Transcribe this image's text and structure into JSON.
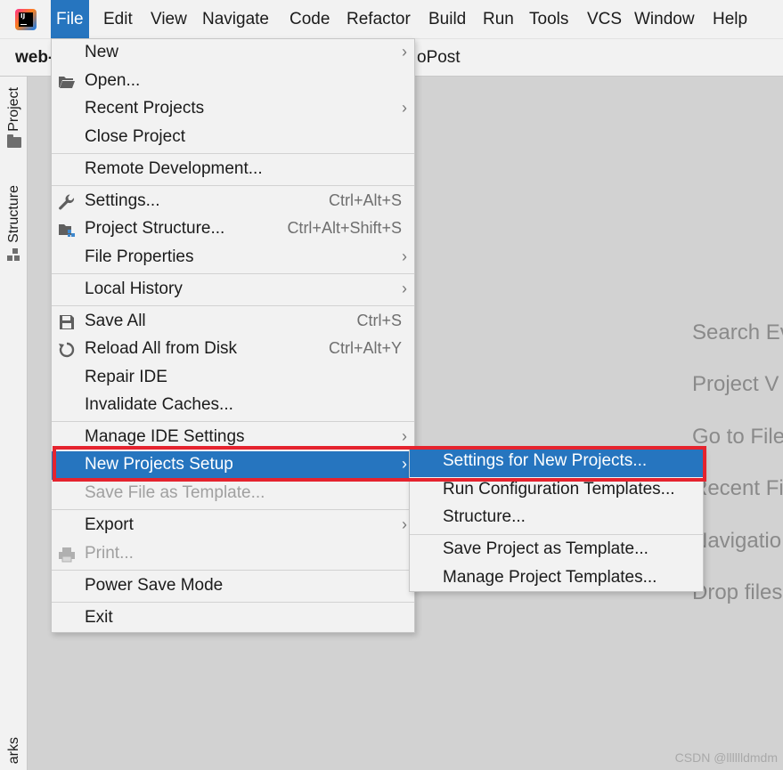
{
  "menubar": {
    "items": [
      {
        "label": "File",
        "active": true
      },
      {
        "label": "Edit"
      },
      {
        "label": "View"
      },
      {
        "label": "Navigate"
      },
      {
        "label": "Code"
      },
      {
        "label": "Refactor"
      },
      {
        "label": "Build"
      },
      {
        "label": "Run"
      },
      {
        "label": "Tools"
      },
      {
        "label": "VCS"
      },
      {
        "label": "Window"
      },
      {
        "label": "Help"
      }
    ]
  },
  "toolbar": {
    "project_name": "web-",
    "tab_tail": "oPost"
  },
  "left_strip": {
    "project_tab": "Project",
    "structure_tab": "Structure",
    "bookmarks_tab": "arks"
  },
  "welcome_hints": [
    "Search Ev",
    "Project V",
    "Go to File",
    "Recent Fi",
    "Navigatio",
    "Drop files"
  ],
  "file_menu": {
    "items": [
      {
        "label": "New",
        "submenu": true
      },
      {
        "label": "Open...",
        "icon": "folder-open-icon"
      },
      {
        "label": "Recent Projects",
        "submenu": true
      },
      {
        "label": "Close Project"
      },
      {
        "label": "Remote Development..."
      },
      {
        "label": "Settings...",
        "shortcut": "Ctrl+Alt+S",
        "icon": "wrench-icon"
      },
      {
        "label": "Project Structure...",
        "shortcut": "Ctrl+Alt+Shift+S",
        "icon": "project-structure-icon"
      },
      {
        "label": "File Properties",
        "submenu": true
      },
      {
        "label": "Local History",
        "submenu": true
      },
      {
        "label": "Save All",
        "shortcut": "Ctrl+S",
        "icon": "save-icon"
      },
      {
        "label": "Reload All from Disk",
        "shortcut": "Ctrl+Alt+Y",
        "icon": "reload-icon"
      },
      {
        "label": "Repair IDE"
      },
      {
        "label": "Invalidate Caches..."
      },
      {
        "label": "Manage IDE Settings",
        "submenu": true
      },
      {
        "label": "New Projects Setup",
        "submenu": true,
        "highlighted": true
      },
      {
        "label": "Save File as Template...",
        "disabled": true
      },
      {
        "label": "Export",
        "submenu": true
      },
      {
        "label": "Print...",
        "disabled": true,
        "icon": "printer-icon"
      },
      {
        "label": "Power Save Mode"
      },
      {
        "label": "Exit"
      }
    ]
  },
  "new_projects_setup_submenu": {
    "items": [
      {
        "label": "Settings for New Projects...",
        "highlighted": true
      },
      {
        "label": "Run Configuration Templates..."
      },
      {
        "label": "Structure..."
      },
      {
        "label": "Save Project as Template..."
      },
      {
        "label": "Manage Project Templates..."
      }
    ]
  },
  "watermark": "CSDN @lllllldmdm",
  "colors": {
    "menu_highlight": "#2675bf",
    "annotation_red": "#e5232e",
    "menu_bg": "#f2f2f2",
    "workspace_bg": "#d2d2d2"
  }
}
